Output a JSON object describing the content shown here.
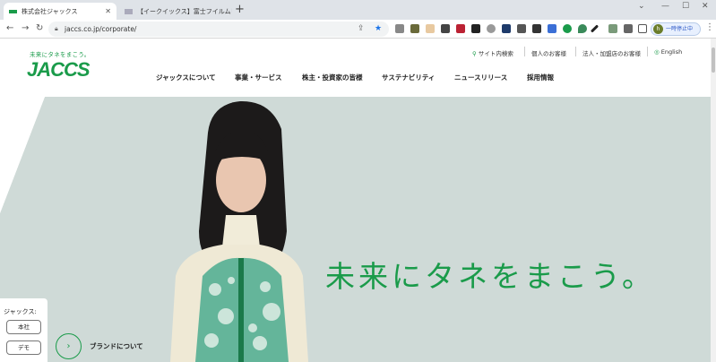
{
  "browser": {
    "tabs": [
      {
        "title": "株式会社ジャックス",
        "active": true
      },
      {
        "title": "【イークイックス】富士フイルムビジネ…",
        "active": false
      }
    ],
    "url": "jaccs.co.jp/corporate/",
    "profile_label": "一時停止中",
    "window_controls": {
      "minimize": "—",
      "maximize": "☐",
      "close": "✕"
    }
  },
  "header": {
    "logo_tagline": "未来にタネをまこう。",
    "logo_text": "JACCS",
    "utility_links": {
      "site_search": "サイト内検索",
      "personal": "個人のお客様",
      "business": "法人・加盟店のお客様",
      "english": "English"
    },
    "global_nav": [
      "ジャックスについて",
      "事業・サービス",
      "株主・投資家の皆様",
      "サステナビリティ",
      "ニュースリリース",
      "採用情報"
    ]
  },
  "hero": {
    "catchphrase": "未来にタネをまこう。",
    "brand_link": "ブランドについて"
  },
  "side_widget": {
    "title": "ジャックス:",
    "buttons": [
      "本社",
      "デモ"
    ]
  },
  "colors": {
    "brand_green": "#1a9b4a",
    "hero_bg": "#cfdad7"
  }
}
